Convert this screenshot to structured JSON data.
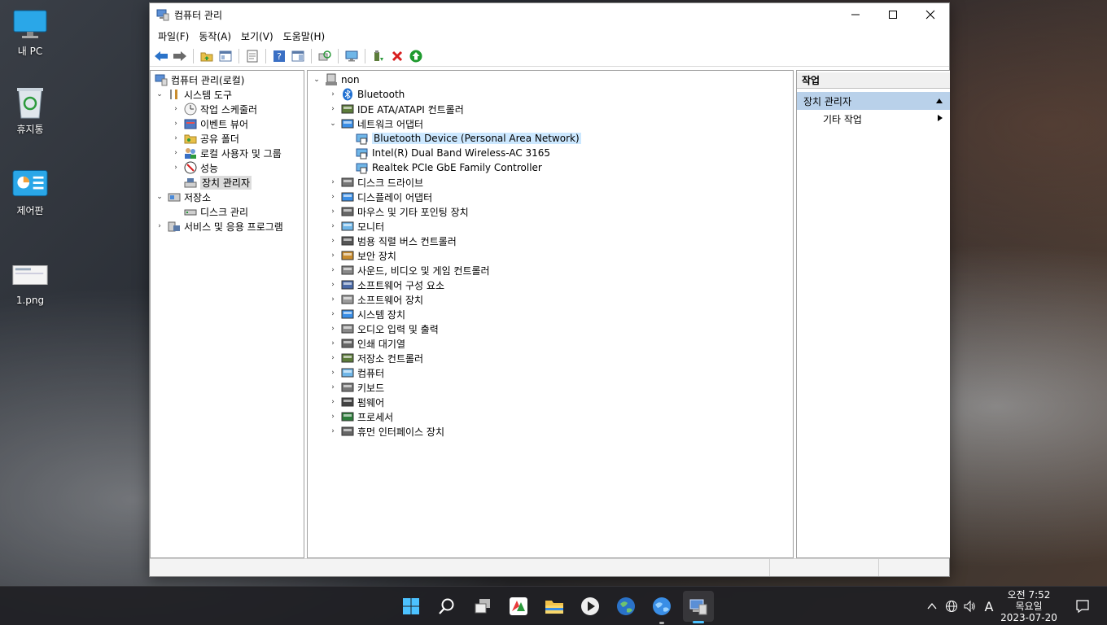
{
  "desktop": {
    "icons": [
      {
        "label": "내 PC"
      },
      {
        "label": "휴지통"
      },
      {
        "label": "제어판"
      },
      {
        "label": "1.png"
      }
    ]
  },
  "window": {
    "title": "컴퓨터 관리",
    "menu": [
      "파일(F)",
      "동작(A)",
      "보기(V)",
      "도움말(H)"
    ]
  },
  "left_tree": [
    {
      "label": "컴퓨터 관리(로컬)",
      "icon": "computer-management-icon"
    },
    {
      "label": "시스템 도구",
      "icon": "tools-icon"
    },
    {
      "label": "작업 스케줄러",
      "icon": "clock-icon"
    },
    {
      "label": "이벤트 뷰어",
      "icon": "event-viewer-icon"
    },
    {
      "label": "공유 폴더",
      "icon": "shared-folder-icon"
    },
    {
      "label": "로컬 사용자 및 그룹",
      "icon": "users-icon"
    },
    {
      "label": "성능",
      "icon": "performance-icon"
    },
    {
      "label": "장치 관리자",
      "icon": "device-manager-icon"
    },
    {
      "label": "저장소",
      "icon": "storage-icon"
    },
    {
      "label": "디스크 관리",
      "icon": "disk-icon"
    },
    {
      "label": "서비스 및 응용 프로그램",
      "icon": "services-icon"
    }
  ],
  "device_tree": {
    "root": "non",
    "categories": [
      "Bluetooth",
      "IDE ATA/ATAPI 컨트롤러",
      "네트워크 어댑터",
      "디스크 드라이브",
      "디스플레이 어댑터",
      "마우스 및 기타 포인팅 장치",
      "모니터",
      "범용 직렬 버스 컨트롤러",
      "보안 장치",
      "사운드, 비디오 및 게임 컨트롤러",
      "소프트웨어 구성 요소",
      "소프트웨어 장치",
      "시스템 장치",
      "오디오 입력 및 출력",
      "인쇄 대기열",
      "저장소 컨트롤러",
      "컴퓨터",
      "키보드",
      "펌웨어",
      "프로세서",
      "휴먼 인터페이스 장치"
    ],
    "network_children": [
      "Bluetooth Device (Personal Area Network)",
      "Intel(R) Dual Band Wireless-AC 3165",
      "Realtek PCIe GbE Family Controller"
    ]
  },
  "actions": {
    "header": "작업",
    "section": "장치 관리자",
    "item": "기타 작업"
  },
  "taskbar": {
    "time": "오전 7:52",
    "day": "목요일",
    "date": "2023-07-20",
    "ime": "A"
  },
  "colors": {
    "selection_blue": "#cce8ff",
    "actions_header": "#b9d1ea",
    "accent": "#0067c0"
  }
}
